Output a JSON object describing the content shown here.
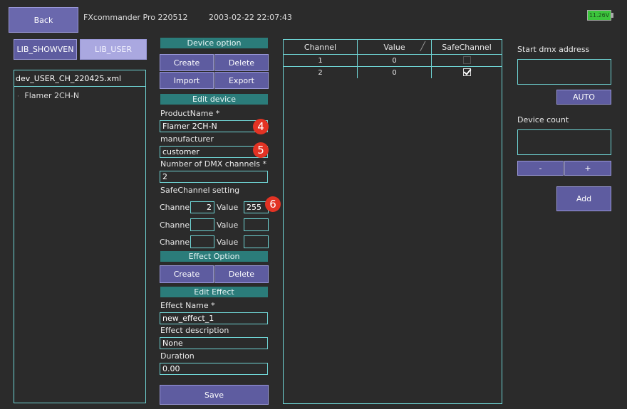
{
  "topbar": {
    "back_label": "Back",
    "app_title": "FXcommander Pro 220512",
    "datetime": "2003-02-22 22:07:43",
    "battery": "11.26V"
  },
  "library": {
    "tab_showven": "LIB_SHOWVEN",
    "tab_user": "LIB_USER",
    "file_name": "dev_USER_CH_220425.xml",
    "items": [
      "Flamer 2CH-N"
    ]
  },
  "device_option": {
    "header": "Device option",
    "create": "Create",
    "delete": "Delete",
    "import": "Import",
    "export": "Export"
  },
  "edit_device": {
    "header": "Edit device",
    "product_name_label": "ProductName *",
    "product_name_value": "Flamer 2CH-N",
    "manufacturer_label": "manufacturer",
    "manufacturer_value": "customer",
    "dmx_channels_label": "Number of DMX channels *",
    "dmx_channels_value": "2",
    "safe_channel_label": "SafeChannel setting",
    "channel_label": "Channel",
    "value_label": "Value",
    "safe_rows": [
      {
        "channel": "2",
        "value": "255"
      },
      {
        "channel": "",
        "value": ""
      },
      {
        "channel": "",
        "value": ""
      }
    ]
  },
  "effect_option": {
    "header": "Effect Option",
    "create": "Create",
    "delete": "Delete"
  },
  "edit_effect": {
    "header": "Edit Effect",
    "name_label": "Effect Name *",
    "name_value": "new_effect_1",
    "desc_label": "Effect description",
    "desc_value": "None",
    "duration_label": "Duration",
    "duration_value": "0.00",
    "save": "Save"
  },
  "channel_table": {
    "headers": [
      "Channel",
      "Value",
      "SafeChannel"
    ],
    "rows": [
      {
        "channel": "1",
        "value": "0",
        "safe": false
      },
      {
        "channel": "2",
        "value": "0",
        "safe": true
      }
    ]
  },
  "right_panel": {
    "start_dmx_label": "Start dmx address",
    "start_dmx_value": "",
    "auto": "AUTO",
    "device_count_label": "Device count",
    "device_count_value": "",
    "minus": "-",
    "plus": "+",
    "add": "Add"
  },
  "badges": [
    "4",
    "5",
    "6"
  ],
  "colors": {
    "accent_teal": "#2b7c7a",
    "button_purple": "#5e5ca0",
    "border_cyan": "#6fd4d4",
    "badge_red": "#e23324",
    "battery_green": "#3cc43c"
  }
}
